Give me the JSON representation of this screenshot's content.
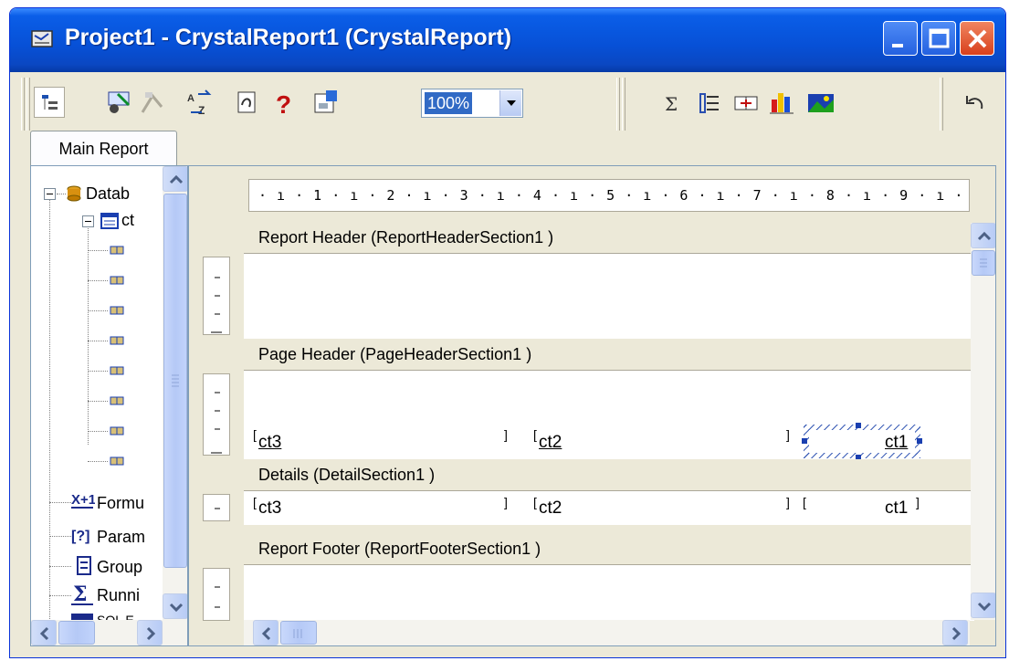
{
  "window": {
    "title": "Project1 - CrystalReport1 (CrystalReport)",
    "title_icon": "report-designer-icon",
    "buttons": [
      "minimize-icon",
      "maximize-icon",
      "close-icon"
    ]
  },
  "toolbar": {
    "icons": [
      "toggle-field-tree-icon",
      "format-field-icon",
      "select-expert-icon",
      "sort-order-icon",
      "field-explorer-icon",
      "help-icon",
      "insert-group-icon",
      "summary-icon",
      "insert-group-section-icon",
      "insert-subreport-icon",
      "insert-chart-icon",
      "insert-picture-icon",
      "undo-icon"
    ],
    "zoom": "100%"
  },
  "tabs": [
    "Main Report"
  ],
  "tree": {
    "database": "Datab",
    "table": "ct",
    "field_count": 8,
    "formula": "Formu",
    "parameter": "Param",
    "group": "Group",
    "running": "Runni",
    "sql": "SQL E"
  },
  "ruler": "· ı · 1 · ı · 2 · ı · 3 · ı · 4 · ı · 5 · ı · 6 · ı · 7 · ı · 8 · ı · 9 · ı ·",
  "sections": {
    "report_header": "Report Header  (ReportHeaderSection1 )",
    "page_header": "Page Header  (PageHeaderSection1 )",
    "details": "Details  (DetailSection1 )",
    "report_footer": "Report Footer  (ReportFooterSection1 )"
  },
  "page_header_fields": [
    "ct3",
    "ct2",
    "ct1"
  ],
  "detail_fields": [
    "ct3",
    "ct2",
    "ct1"
  ],
  "colors": {
    "titlebar": "#0a5ee8",
    "window_bg": "#ece9d8",
    "selection": "#316ac5"
  }
}
